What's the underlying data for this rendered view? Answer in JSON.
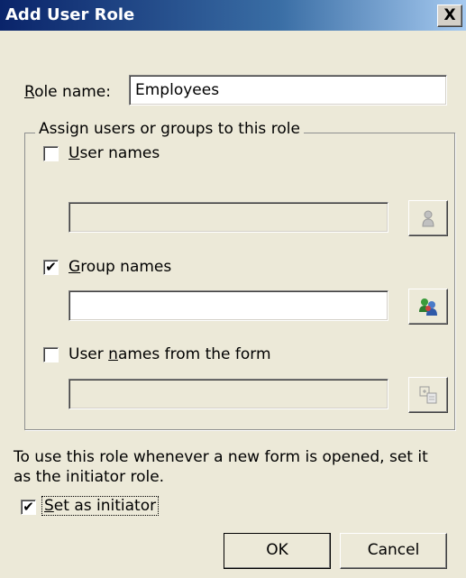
{
  "window": {
    "title": "Add User Role",
    "close_label": "X"
  },
  "role": {
    "label_prefix": "R",
    "label_rest": "ole name:",
    "value": "Employees"
  },
  "group": {
    "legend": "Assign users or groups to this role",
    "user_names": {
      "checked": false,
      "label_u": "U",
      "label_rest": "ser names",
      "value": ""
    },
    "group_names": {
      "checked": true,
      "label_u": "G",
      "label_rest": "roup names",
      "value": ""
    },
    "form_names": {
      "checked": false,
      "label_pre": "User ",
      "label_u": "n",
      "label_rest": "ames from the form",
      "value": ""
    }
  },
  "initiator": {
    "hint_line1": "To use this role whenever a new form is opened, set it",
    "hint_line2": "as the initiator role.",
    "checked": true,
    "label_u": "S",
    "label_rest": "et as initiator"
  },
  "buttons": {
    "ok": "OK",
    "cancel": "Cancel"
  },
  "icons": {
    "user": "user-icon",
    "group": "users-group-icon",
    "form": "form-fields-icon"
  }
}
